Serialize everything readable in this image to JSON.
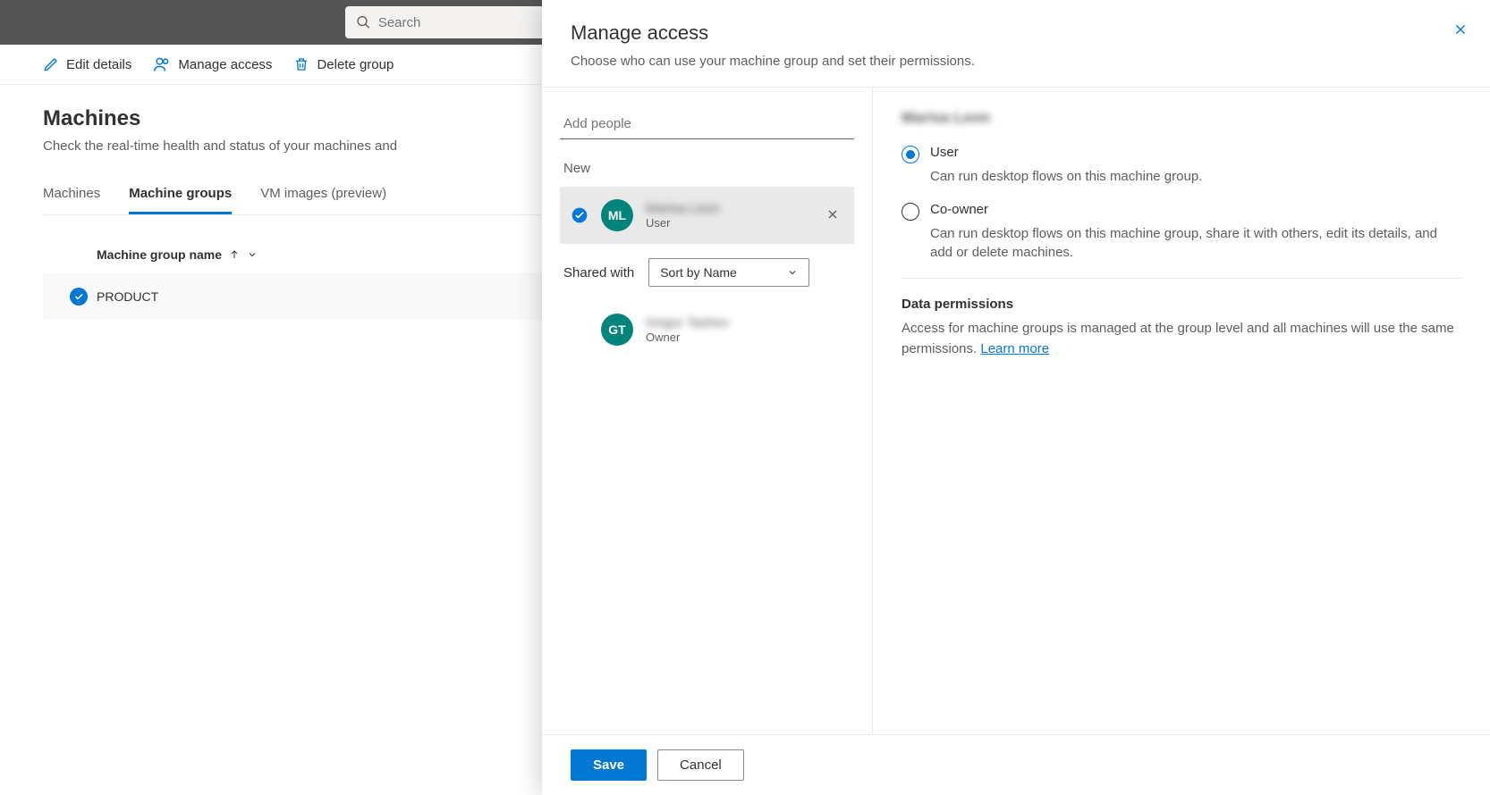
{
  "search": {
    "placeholder": "Search"
  },
  "toolbar": {
    "edit": "Edit details",
    "manage": "Manage access",
    "delete": "Delete group"
  },
  "page": {
    "title": "Machines",
    "desc": "Check the real-time health and status of your machines and"
  },
  "tabs": {
    "machines": "Machines",
    "groups": "Machine groups",
    "vm": "VM images (preview)"
  },
  "table": {
    "header": "Machine group name",
    "row1": "PRODUCT"
  },
  "panel": {
    "title": "Manage access",
    "desc": "Choose who can use your machine group and set their permissions.",
    "add_people_placeholder": "Add people",
    "new_label": "New",
    "shared_with": "Shared with",
    "sort_by": "Sort by Name",
    "people": {
      "new": {
        "initials": "ML",
        "name": "Marisa Leon",
        "role": "User"
      },
      "owner": {
        "initials": "GT",
        "name": "Grigor Tashev",
        "role": "Owner"
      }
    }
  },
  "details": {
    "selected_name": "Marisa Leon",
    "user": {
      "label": "User",
      "desc": "Can run desktop flows on this machine group."
    },
    "coowner": {
      "label": "Co-owner",
      "desc": "Can run desktop flows on this machine group, share it with others, edit its details, and add or delete machines."
    },
    "dp_title": "Data permissions",
    "dp_text": "Access for machine groups is managed at the group level and all machines will use the same permissions. ",
    "dp_link": "Learn more"
  },
  "footer": {
    "save": "Save",
    "cancel": "Cancel"
  }
}
